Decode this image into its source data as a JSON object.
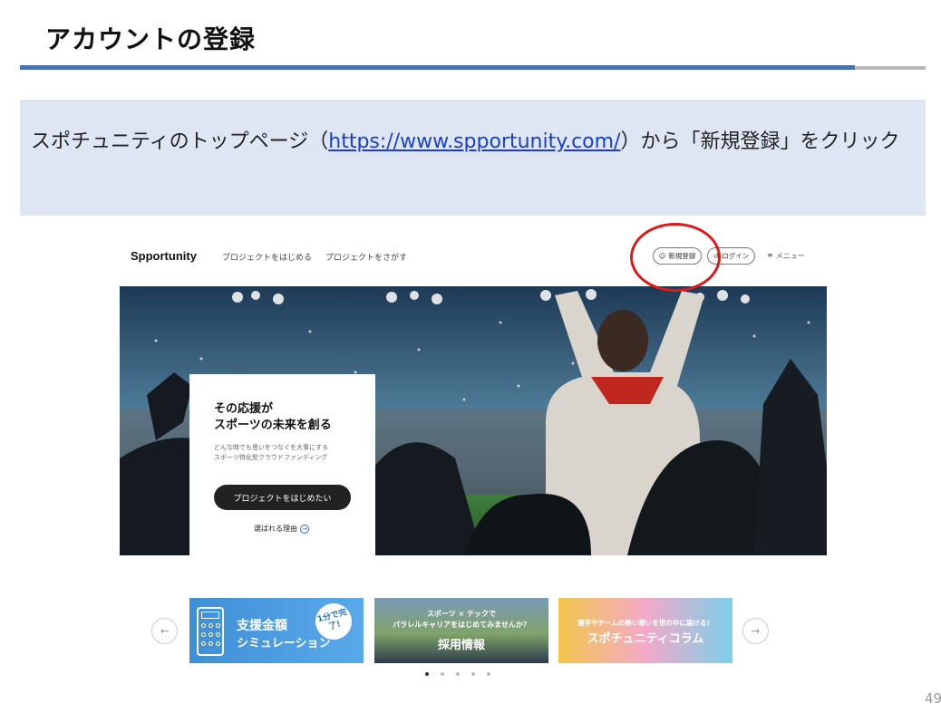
{
  "slide": {
    "title": "アカウントの登録",
    "page_number": "49"
  },
  "instruction": {
    "text_before": "スポチュニティのトップページ（",
    "link": "https://www.spportunity.com/",
    "text_after": "）から「新規登録」をクリック"
  },
  "site": {
    "logo": "Spportunity",
    "nav": {
      "start_project": "プロジェクトをはじめる",
      "find_project": "プロジェクトをさがす",
      "register": "新規登録",
      "login": "ログイン",
      "menu": "メニュー"
    },
    "hero": {
      "headline_line1": "その応援が",
      "headline_line2": "スポーツの未来を創る",
      "sub_line1": "どんな時でも思いをつなぐを大事にする",
      "sub_line2": "スポーツ特化型クラウドファンディング",
      "cta": "プロジェクトをはじめたい",
      "reason": "選ばれる理由"
    },
    "banners": [
      {
        "title": "支援金額",
        "subtitle": "シミュレーション",
        "badge": "1分で完了!"
      },
      {
        "line1": "スポーツ × テックで",
        "line2": "パラレルキャリアをはじめてみませんか？",
        "title": "採用情報"
      },
      {
        "line1": "選手やチームの熱い想いを世の中に届ける！",
        "title": "スポチュニティコラム"
      }
    ],
    "carousel": {
      "dots": 5,
      "active_index": 0
    }
  },
  "colors": {
    "title_rule": "#4a72ad",
    "instruction_bg": "#dde6f2",
    "link": "#1a3fc9",
    "highlight_circle": "#e01818",
    "cta_bg": "#222222"
  }
}
